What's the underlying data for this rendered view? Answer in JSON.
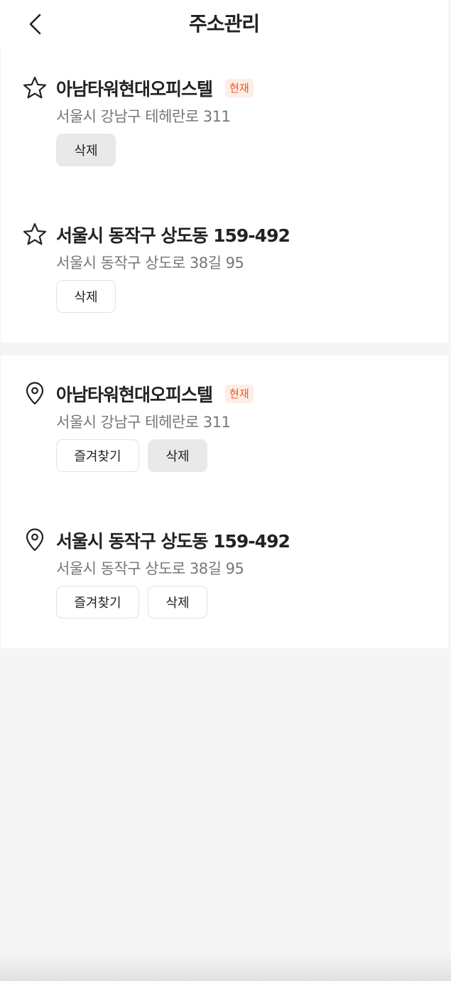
{
  "header": {
    "title": "주소관리"
  },
  "favorites": [
    {
      "title": "아남타워현대오피스텔",
      "badge": "현재",
      "address": "서울시 강남구 테헤란로 311",
      "delete_label": "삭제"
    },
    {
      "title": "서울시 동작구 상도동 159-492",
      "badge": "",
      "address": "서울시 동작구 상도로 38길 95",
      "delete_label": "삭제"
    }
  ],
  "recent": [
    {
      "title": "아남타워현대오피스텔",
      "badge": "현재",
      "address": "서울시 강남구 테헤란로 311",
      "favorite_label": "즐겨찾기",
      "delete_label": "삭제"
    },
    {
      "title": "서울시 동작구 상도동 159-492",
      "badge": "",
      "address": "서울시 동작구 상도로 38길 95",
      "favorite_label": "즐겨찾기",
      "delete_label": "삭제"
    }
  ],
  "colors": {
    "accent": "#ef5a2a",
    "badge_bg": "#fdeee6",
    "background": "#f5f5f5"
  },
  "icons": {
    "back": "chevron-left-icon",
    "favorite": "star-icon",
    "location": "map-pin-icon"
  }
}
